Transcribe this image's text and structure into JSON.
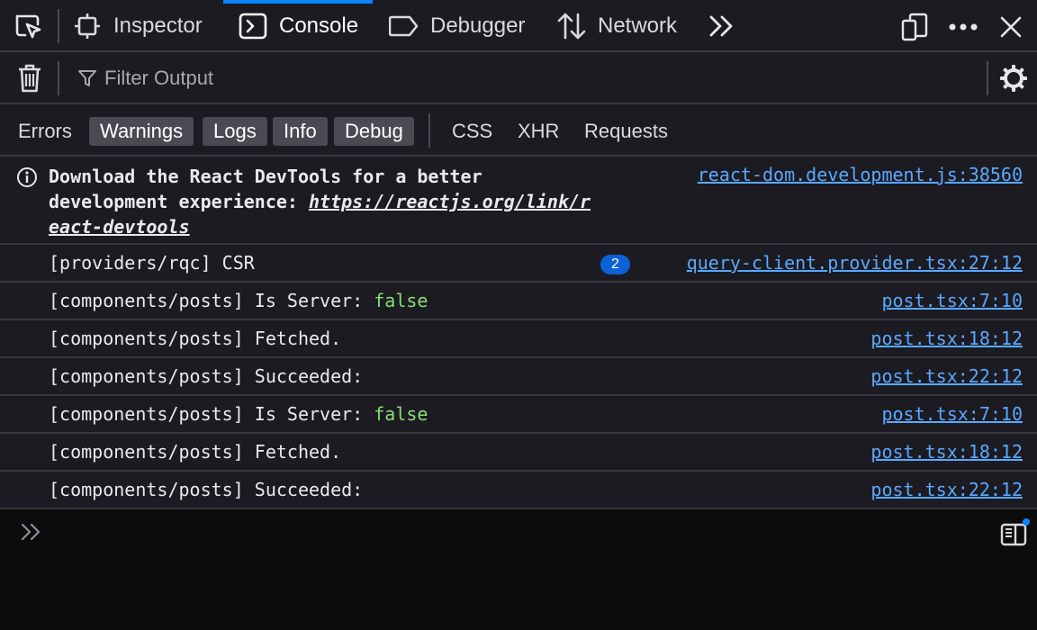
{
  "toolbar": {
    "tabs": [
      {
        "label": "Inspector",
        "icon": "inspector-icon"
      },
      {
        "label": "Console",
        "icon": "console-icon"
      },
      {
        "label": "Debugger",
        "icon": "debugger-icon"
      },
      {
        "label": "Network",
        "icon": "network-icon"
      }
    ],
    "active_tab": "Console"
  },
  "filter": {
    "placeholder": "Filter Output"
  },
  "levels": [
    {
      "label": "Errors",
      "on": false
    },
    {
      "label": "Warnings",
      "on": true
    },
    {
      "label": "Logs",
      "on": true
    },
    {
      "label": "Info",
      "on": true
    },
    {
      "label": "Debug",
      "on": true
    },
    {
      "label": "CSS",
      "on": false
    },
    {
      "label": "XHR",
      "on": false
    },
    {
      "label": "Requests",
      "on": false
    }
  ],
  "messages": {
    "info": {
      "line1": "Download the React DevTools for a better",
      "line2_prefix": "development experience: ",
      "link_part1": "https://reactjs.org/link/r",
      "link_part2": "eact-devtools",
      "source": "react-dom.development.js:38560"
    },
    "logs": [
      {
        "prefix": "[providers/rqc] CSR",
        "value": "",
        "source": "query-client.provider.tsx:27:12",
        "repeat": "2"
      },
      {
        "prefix": "[components/posts] Is Server: ",
        "value": "false",
        "source": "post.tsx:7:10"
      },
      {
        "prefix": "[components/posts] Fetched.",
        "value": "",
        "source": "post.tsx:18:12"
      },
      {
        "prefix": "[components/posts] Succeeded:",
        "value": "",
        "source": "post.tsx:22:12"
      },
      {
        "prefix": "[components/posts] Is Server: ",
        "value": "false",
        "source": "post.tsx:7:10"
      },
      {
        "prefix": "[components/posts] Fetched.",
        "value": "",
        "source": "post.tsx:18:12"
      },
      {
        "prefix": "[components/posts] Succeeded:",
        "value": "",
        "source": "post.tsx:22:12"
      }
    ]
  },
  "colors": {
    "accent": "#0a84ff",
    "link": "#5aa8ff",
    "boolean": "#86de74",
    "badge": "#0b62d6"
  }
}
